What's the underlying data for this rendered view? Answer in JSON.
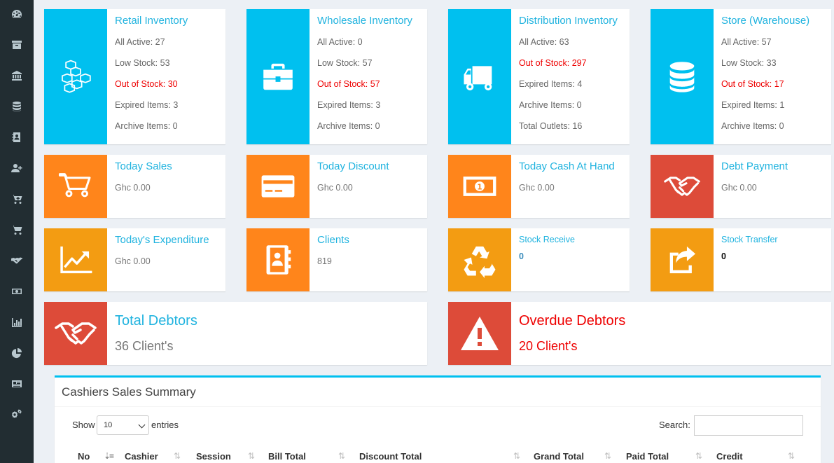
{
  "colors": {
    "blue": "#00c0ef",
    "orange": "#ff851b",
    "yellow": "#f39c12",
    "red": "#dd4b39",
    "sidebar": "#222d32"
  },
  "sidebar": {
    "icons": [
      "dashboard-icon",
      "archive-icon",
      "bank-icon",
      "database-icon",
      "contact-book-icon",
      "add-user-icon",
      "cart-plus-icon",
      "cart-icon",
      "handshake-icon",
      "money-icon",
      "bar-chart-icon",
      "pie-chart-icon",
      "newspaper-icon",
      "cogs-icon"
    ]
  },
  "inventory": [
    {
      "title": "Retail Inventory",
      "icon": "cubes-icon",
      "lines": [
        "All Active: 27",
        "Low Stock: 53",
        "Out of Stock: 30",
        "Expired Items: 3",
        "Archive Items: 0"
      ]
    },
    {
      "title": "Wholesale Inventory",
      "icon": "briefcase-icon",
      "lines": [
        "All Active: 0",
        "Low Stock: 57",
        "Out of Stock: 57",
        "Expired Items: 3",
        "Archive Items: 0"
      ]
    },
    {
      "title": "Distribution Inventory",
      "icon": "truck-icon",
      "lines": [
        "All Active: 63",
        "Out of Stock: 297",
        "Expired Items: 4",
        "Archive Items: 0",
        "Total Outlets: 16"
      ]
    },
    {
      "title": "Store (Warehouse)",
      "icon": "database-icon",
      "lines": [
        "All Active: 57",
        "Low Stock: 33",
        "Out of Stock: 17",
        "Expired Items: 1",
        "Archive Items: 0"
      ]
    }
  ],
  "money_cards": [
    {
      "title": "Today Sales",
      "value": "Ghc 0.00",
      "icon": "shopping-cart-icon"
    },
    {
      "title": "Today Discount",
      "value": "Ghc 0.00",
      "icon": "credit-card-icon"
    },
    {
      "title": "Today Cash At Hand",
      "value": "Ghc 0.00",
      "icon": "money-bill-icon"
    },
    {
      "title": "Debt Payment",
      "value": "Ghc 0.00",
      "icon": "handshake-icon"
    }
  ],
  "row3_cards": [
    {
      "title": "Today's Expenditure",
      "value": "Ghc 0.00",
      "icon": "line-chart-icon"
    },
    {
      "title": "Clients",
      "value": "819",
      "icon": "address-book-icon"
    },
    {
      "title": "Stock Receive",
      "value": "0",
      "icon": "recycle-icon"
    },
    {
      "title": "Stock Transfer",
      "value": "0",
      "icon": "share-icon"
    }
  ],
  "debtors": [
    {
      "title": "Total Debtors",
      "value": "36 Client's",
      "icon": "handshake-icon"
    },
    {
      "title": "Overdue Debtors",
      "value": "20 Client's",
      "icon": "warning-icon"
    }
  ],
  "summary": {
    "title": "Cashiers Sales Summary",
    "show_label": "Show",
    "length_value": "10",
    "entries_label": "entries",
    "search_label": "Search:",
    "search_value": "",
    "columns": [
      "No",
      "Cashier",
      "Session",
      "Bill Total",
      "Discount Total",
      "Grand Total",
      "Paid Total",
      "Credit"
    ]
  }
}
